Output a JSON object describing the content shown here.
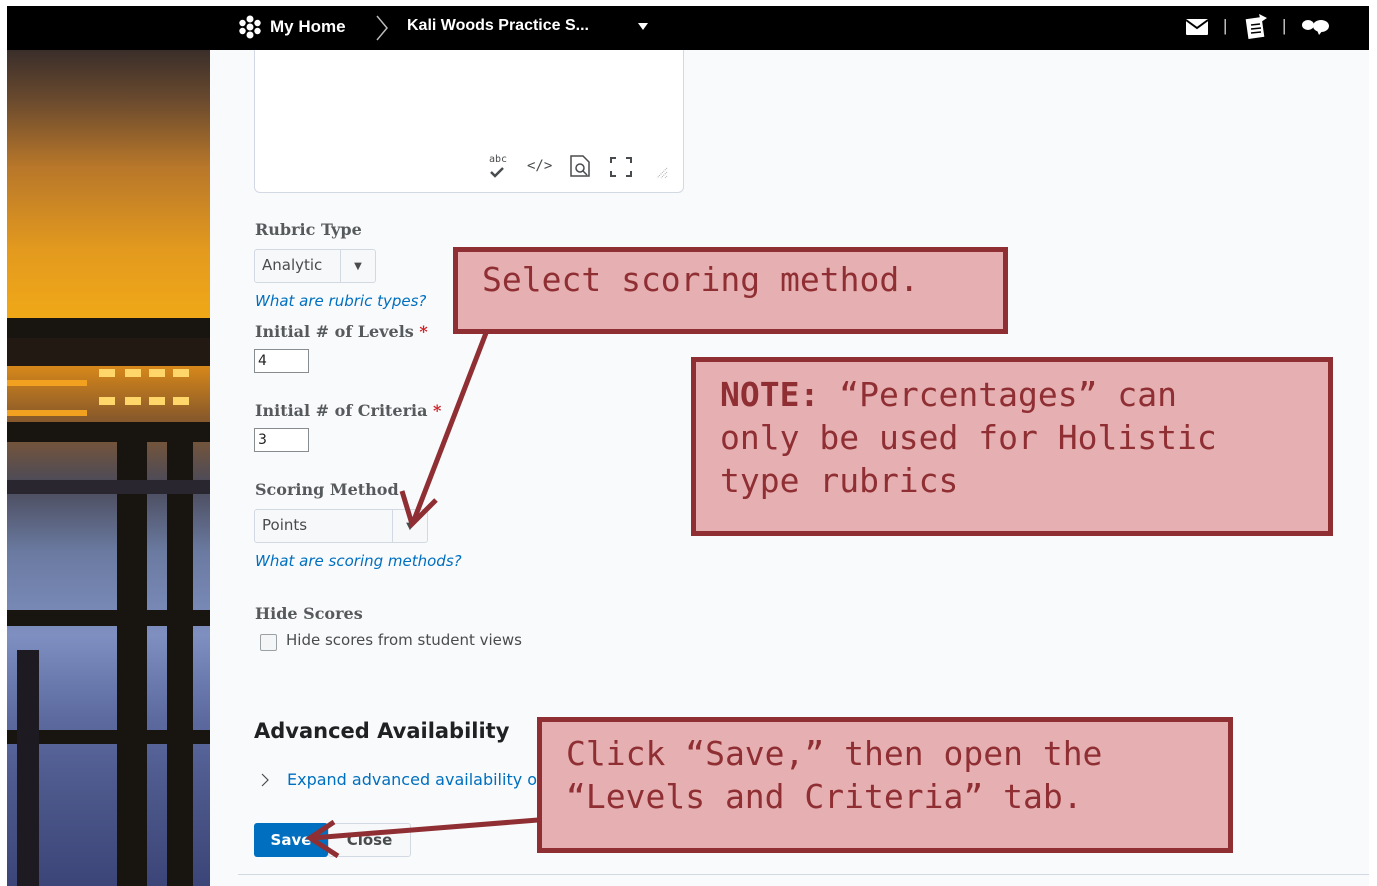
{
  "topbar": {
    "home_label": "My Home",
    "course_label": "Kali Woods Practice S...",
    "separator": "|"
  },
  "editor_toolbar": {
    "spellcheck_label": "abc",
    "source_label": "</>"
  },
  "form": {
    "rubric_type_label": "Rubric Type",
    "rubric_type_value": "Analytic",
    "rubric_types_link": "What are rubric types?",
    "levels_label": "Initial # of Levels",
    "levels_value": "4",
    "criteria_label": "Initial # of Criteria",
    "criteria_value": "3",
    "required_mark": "*",
    "scoring_label": "Scoring Method",
    "scoring_value": "Points",
    "scoring_link": "What are scoring methods?",
    "hide_scores_label": "Hide Scores",
    "hide_scores_checkbox_label": "Hide scores from student views",
    "advanced_heading": "Advanced Availability",
    "expand_link": "Expand advanced availability o"
  },
  "buttons": {
    "save": "Save",
    "close": "Close"
  },
  "callouts": {
    "scoring": "Select scoring method.",
    "note_bold": "NOTE:",
    "note_rest": " “Percentages” can\nonly be used for Holistic\ntype rubrics",
    "save": "Click “Save,” then open the\n“Levels and Criteria” tab."
  },
  "colors": {
    "callout_fill": "#e6b0b2",
    "callout_border": "#8f2f33",
    "primary_button": "#006fbf",
    "link": "#006fbf"
  }
}
